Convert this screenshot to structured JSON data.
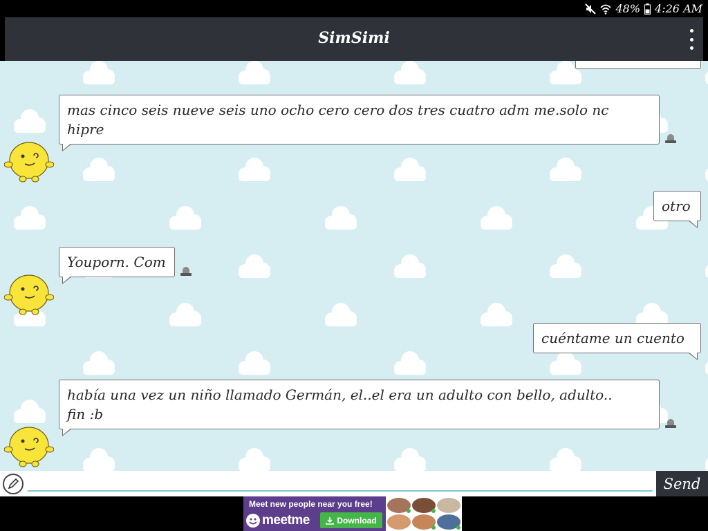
{
  "status_bar": {
    "battery": "48%",
    "time": "4:26 AM",
    "icons": [
      "mute-icon",
      "wifi-icon",
      "battery-icon"
    ]
  },
  "header": {
    "title": "SimSimi",
    "menu_icon": "overflow-menu-icon"
  },
  "messages": [
    {
      "sender": "simsimi",
      "text_lines": [
        "mas cinco seis nueve seis uno ocho cero cero dos tres cuatro adm me.solo nc",
        "hipre"
      ],
      "report_icon": "report-icon"
    },
    {
      "sender": "user",
      "text_lines": [
        "otro"
      ]
    },
    {
      "sender": "simsimi",
      "text_lines": [
        "Youporn. Com"
      ],
      "report_icon": "report-icon"
    },
    {
      "sender": "user",
      "text_lines": [
        "cuéntame un cuento"
      ]
    },
    {
      "sender": "simsimi",
      "text_lines": [
        "había una vez un niño llamado Germán, el..el era un adulto con bello, adulto..",
        "fin :b"
      ],
      "report_icon": "report-icon"
    }
  ],
  "input_bar": {
    "value": "",
    "pencil_icon": "pencil-icon",
    "send_label": "Send"
  },
  "ad": {
    "tagline": "Meet new people near you free!",
    "brand": "meetme",
    "download_label": "Download"
  },
  "colors": {
    "header_bg": "#30323a",
    "chat_bg": "#d6eef2",
    "bubble_border": "#6f6f6f",
    "avatar_yellow": "#f9e43a",
    "ad_purple": "#5c3e8c",
    "ad_green": "#45b549"
  }
}
